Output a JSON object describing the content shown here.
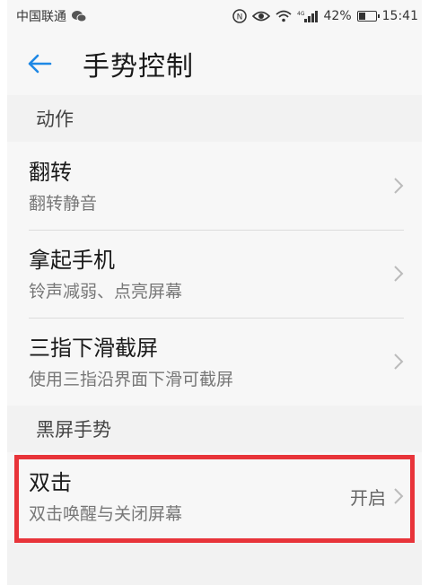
{
  "status_bar": {
    "carrier": "中国联通",
    "chat_icon": "wechat-icon",
    "network": "4G",
    "battery_percent": "42%",
    "battery_level": 0.42,
    "time": "15:41"
  },
  "header": {
    "back_icon": "arrow-left-icon",
    "title": "手势控制"
  },
  "sections": [
    {
      "header": "动作",
      "items": [
        {
          "title": "翻转",
          "subtitle": "翻转静音",
          "value": ""
        },
        {
          "title": "拿起手机",
          "subtitle": "铃声减弱、点亮屏幕",
          "value": ""
        },
        {
          "title": "三指下滑截屏",
          "subtitle": "使用三指沿界面下滑可截屏",
          "value": ""
        }
      ]
    },
    {
      "header": "黑屏手势",
      "items": [
        {
          "title": "双击",
          "subtitle": "双击唤醒与关闭屏幕",
          "value": "开启"
        }
      ]
    }
  ],
  "colors": {
    "accent": "#1e88e5",
    "highlight": "#e8343a",
    "background": "#f2f2f2"
  }
}
